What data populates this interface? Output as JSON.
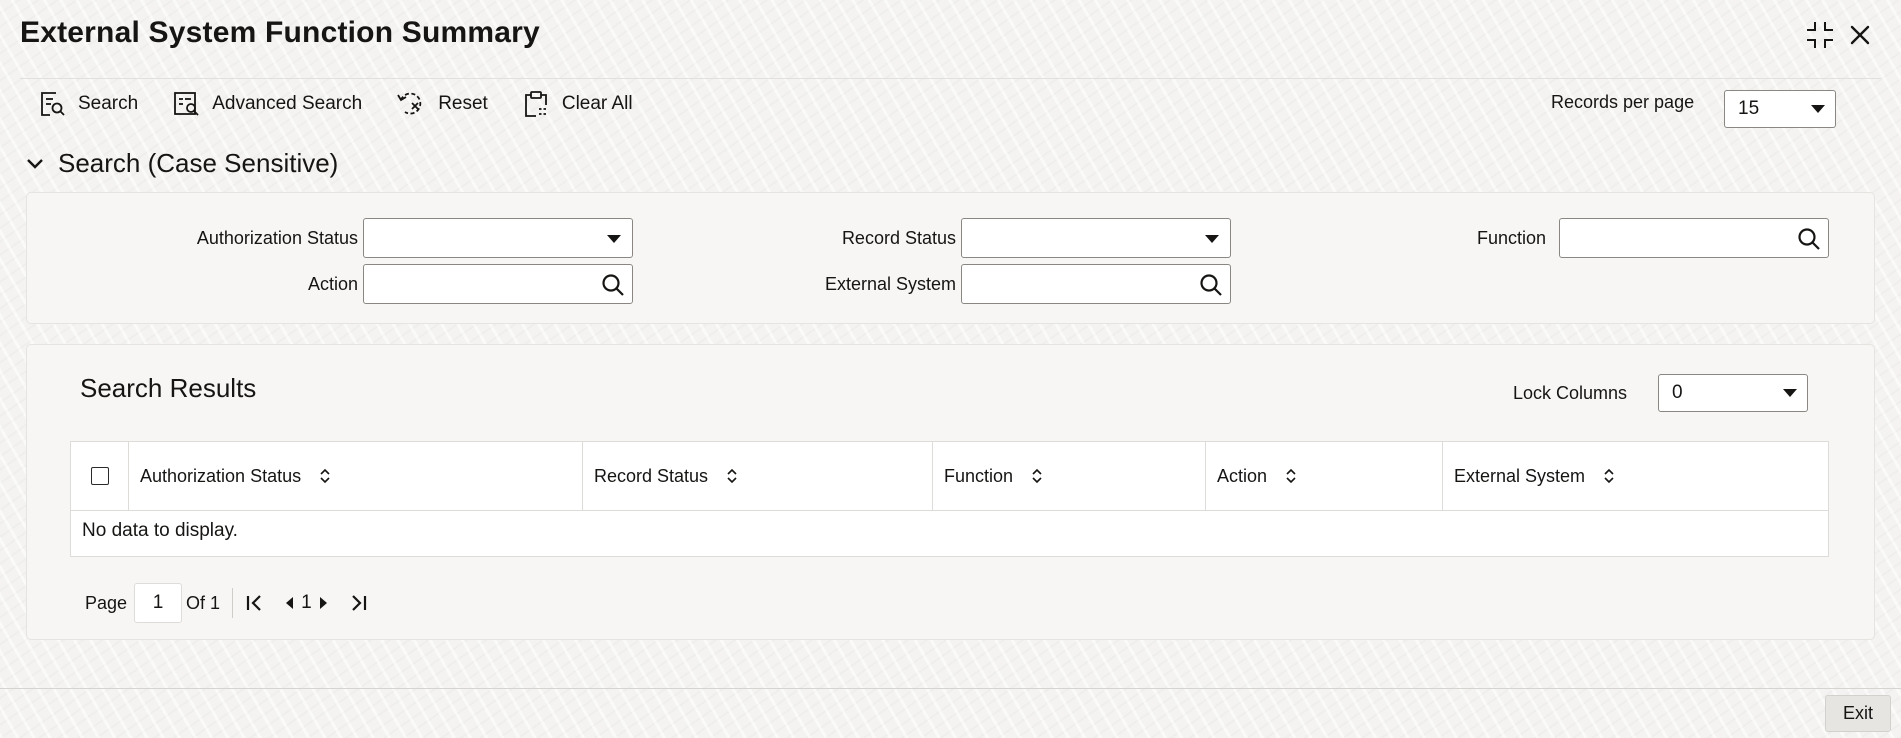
{
  "window": {
    "title": "External System Function Summary"
  },
  "toolbar": {
    "search": "Search",
    "advanced_search": "Advanced Search",
    "reset": "Reset",
    "clear_all": "Clear All"
  },
  "records_per_page": {
    "label": "Records per page",
    "value": "15"
  },
  "search_section": {
    "title": "Search (Case Sensitive)",
    "fields": {
      "authorization_status": {
        "label": "Authorization Status",
        "value": ""
      },
      "record_status": {
        "label": "Record Status",
        "value": ""
      },
      "function": {
        "label": "Function",
        "value": ""
      },
      "action": {
        "label": "Action",
        "value": ""
      },
      "external_system": {
        "label": "External System",
        "value": ""
      }
    }
  },
  "results": {
    "title": "Search Results",
    "lock_columns": {
      "label": "Lock Columns",
      "value": "0"
    },
    "columns": [
      "Authorization Status",
      "Record Status",
      "Function",
      "Action",
      "External System"
    ],
    "empty_message": "No data to display.",
    "pagination": {
      "page_label": "Page",
      "current_page": "1",
      "of_label": "Of 1",
      "page_number": "1"
    }
  },
  "footer": {
    "exit": "Exit"
  }
}
